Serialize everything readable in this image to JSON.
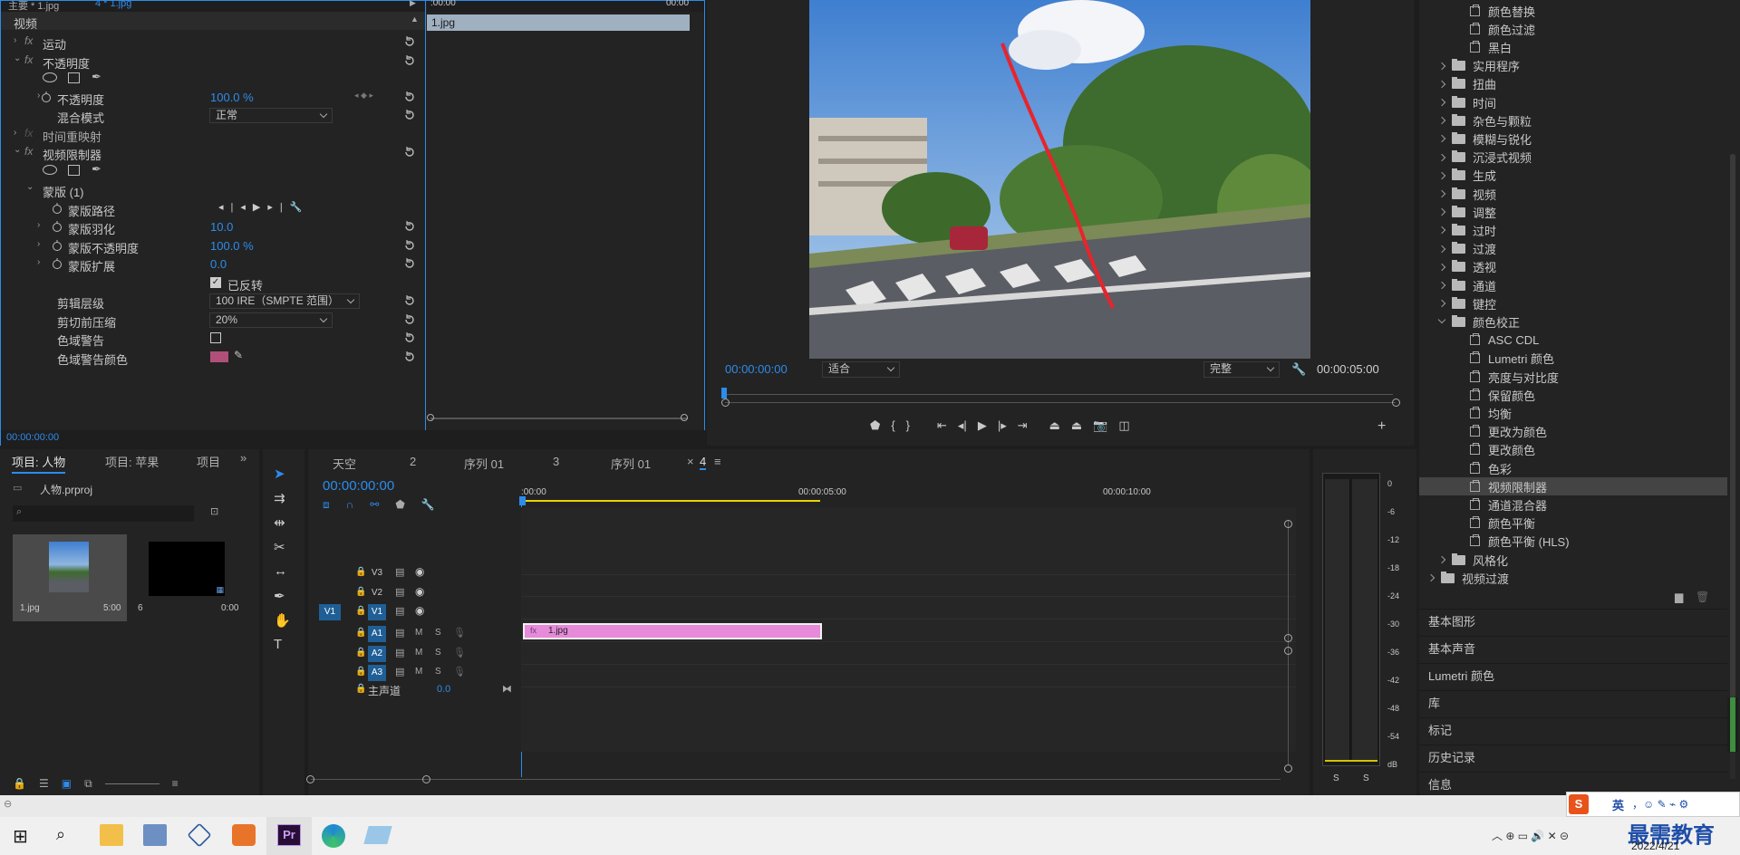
{
  "effect_controls": {
    "source_tab": "主要 * 1.jpg",
    "seq_tab": "4 * 1.jpg",
    "time_start": ":00:00",
    "time_end": "00:00",
    "section": "视频",
    "clip_label": "1.jpg",
    "motion": "运动",
    "opacity_group": "不透明度",
    "opacity": "不透明度",
    "opacity_val": "100.0 %",
    "blend": "混合模式",
    "blend_val": "正常",
    "timeremap": "时间重映射",
    "limiter": "视频限制器",
    "mask": "蒙版 (1)",
    "mask_path": "蒙版路径",
    "mask_feather": "蒙版羽化",
    "mask_feather_val": "10.0",
    "mask_opacity": "蒙版不透明度",
    "mask_opacity_val": "100.0 %",
    "mask_expand": "蒙版扩展",
    "mask_expand_val": "0.0",
    "inverted": "已反转",
    "clip_level": "剪辑层级",
    "clip_level_val": "100 IRE（SMPTE 范围）",
    "compress": "剪切前压缩",
    "compress_val": "20%",
    "gamut": "色域警告",
    "gamut_color": "色域警告颜色",
    "timecode": "00:00:00:00",
    "gamut_swatch": "#b0507a"
  },
  "monitor": {
    "timecode": "00:00:00:00",
    "fit": "适合",
    "quality": "完整",
    "duration": "00:00:05:00"
  },
  "effects": {
    "items": [
      {
        "t": "颜色替换",
        "k": "fx",
        "l": 2
      },
      {
        "t": "颜色过滤",
        "k": "fx",
        "l": 2
      },
      {
        "t": "黑白",
        "k": "fx",
        "l": 2
      },
      {
        "t": "实用程序",
        "k": "f",
        "l": 1
      },
      {
        "t": "扭曲",
        "k": "f",
        "l": 1
      },
      {
        "t": "时间",
        "k": "f",
        "l": 1
      },
      {
        "t": "杂色与颗粒",
        "k": "f",
        "l": 1
      },
      {
        "t": "模糊与锐化",
        "k": "f",
        "l": 1
      },
      {
        "t": "沉浸式视频",
        "k": "f",
        "l": 1
      },
      {
        "t": "生成",
        "k": "f",
        "l": 1
      },
      {
        "t": "视频",
        "k": "f",
        "l": 1
      },
      {
        "t": "调整",
        "k": "f",
        "l": 1
      },
      {
        "t": "过时",
        "k": "f",
        "l": 1
      },
      {
        "t": "过渡",
        "k": "f",
        "l": 1
      },
      {
        "t": "透视",
        "k": "f",
        "l": 1
      },
      {
        "t": "通道",
        "k": "f",
        "l": 1
      },
      {
        "t": "键控",
        "k": "f",
        "l": 1
      },
      {
        "t": "颜色校正",
        "k": "fo",
        "l": 1
      },
      {
        "t": "ASC CDL",
        "k": "fx",
        "l": 2
      },
      {
        "t": "Lumetri 颜色",
        "k": "fx",
        "l": 2
      },
      {
        "t": "亮度与对比度",
        "k": "fx",
        "l": 2
      },
      {
        "t": "保留颜色",
        "k": "fx",
        "l": 2
      },
      {
        "t": "均衡",
        "k": "fx",
        "l": 2
      },
      {
        "t": "更改为颜色",
        "k": "fx",
        "l": 2
      },
      {
        "t": "更改颜色",
        "k": "fx",
        "l": 2
      },
      {
        "t": "色彩",
        "k": "fx",
        "l": 2
      },
      {
        "t": "视频限制器",
        "k": "fx",
        "l": 2,
        "sel": true
      },
      {
        "t": "通道混合器",
        "k": "fx",
        "l": 2
      },
      {
        "t": "颜色平衡",
        "k": "fx",
        "l": 2
      },
      {
        "t": "颜色平衡 (HLS)",
        "k": "fx",
        "l": 2
      },
      {
        "t": "风格化",
        "k": "f",
        "l": 1
      },
      {
        "t": "视频过渡",
        "k": "f",
        "l": 0
      }
    ],
    "panels": [
      "基本图形",
      "基本声音",
      "Lumetri 颜色",
      "库",
      "标记",
      "历史记录",
      "信息"
    ]
  },
  "project": {
    "tabs": [
      "项目: 人物",
      "项目: 苹果",
      "项目"
    ],
    "file": "人物.prproj",
    "items": [
      {
        "name": "1.jpg",
        "dur": "5:00"
      },
      {
        "name": "6",
        "dur": "0:00"
      }
    ]
  },
  "timeline": {
    "tabs": [
      "天空",
      "2",
      "序列 01",
      "3",
      "序列 01",
      "4"
    ],
    "timecode": "00:00:00:00",
    "ruler": [
      ":00:00",
      "00:00:05:00",
      "00:00:10:00"
    ],
    "video_tracks": [
      "V3",
      "V2",
      "V1"
    ],
    "audio_tracks": [
      "A1",
      "A2",
      "A3"
    ],
    "src": "V1",
    "master": "主声道",
    "master_val": "0.0",
    "clip": "1.jpg",
    "m": "M",
    "s": "S"
  },
  "meter": {
    "scale": [
      "0",
      "-6",
      "-12",
      "-18",
      "-24",
      "-30",
      "-36",
      "-42",
      "-48",
      "-54",
      "dB"
    ],
    "solo": [
      "S",
      "S"
    ]
  },
  "taskbar": {
    "time": "",
    "date": "2022/4/21",
    "ime": "英",
    "watermark": "最需教育"
  }
}
